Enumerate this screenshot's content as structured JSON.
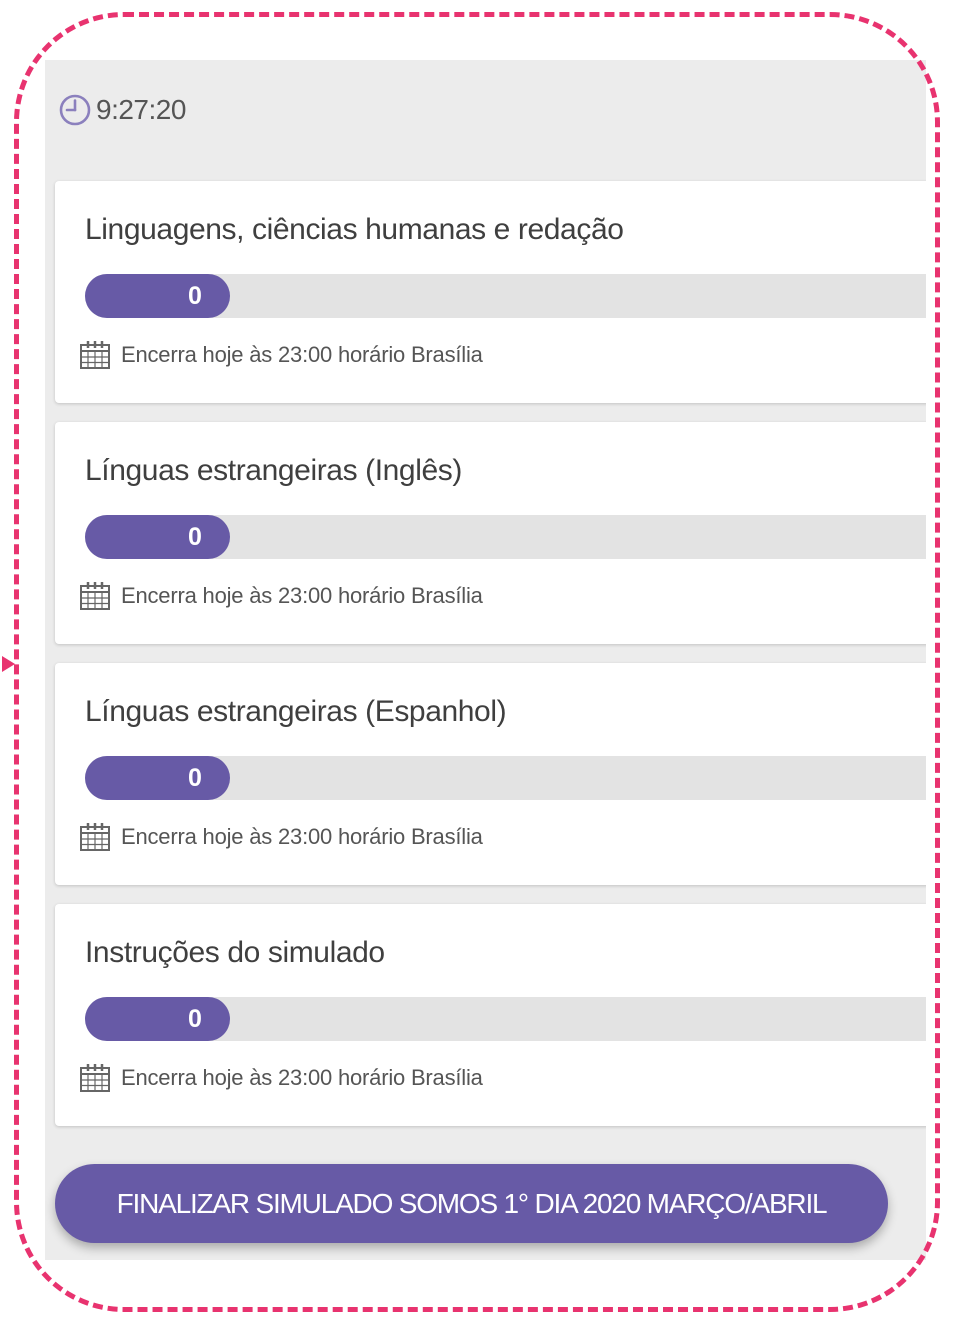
{
  "timer": {
    "icon": "clock-icon",
    "time": "9:27:20"
  },
  "cards": [
    {
      "title": "Linguagens, ciências humanas e redação",
      "progress": 0,
      "progress_label": "0",
      "deadline_icon": "calendar-icon",
      "deadline": "Encerra hoje às 23:00 horário Brasília"
    },
    {
      "title": "Línguas estrangeiras (Inglês)",
      "progress": 0,
      "progress_label": "0",
      "deadline_icon": "calendar-icon",
      "deadline": "Encerra hoje às 23:00 horário Brasília"
    },
    {
      "title": "Línguas estrangeiras (Espanhol)",
      "progress": 0,
      "progress_label": "0",
      "deadline_icon": "calendar-icon",
      "deadline": "Encerra hoje às 23:00 horário Brasília"
    },
    {
      "title": "Instruções do simulado",
      "progress": 0,
      "progress_label": "0",
      "deadline_icon": "calendar-icon",
      "deadline": "Encerra hoje às 23:00 horário Brasília"
    }
  ],
  "finish_button": {
    "label": "FINALIZAR SIMULADO SOMOS 1° DIA 2020 MARÇO/ABRIL"
  },
  "colors": {
    "accent": "#675aa6",
    "frame": "#e8336f",
    "background": "#ececec"
  }
}
